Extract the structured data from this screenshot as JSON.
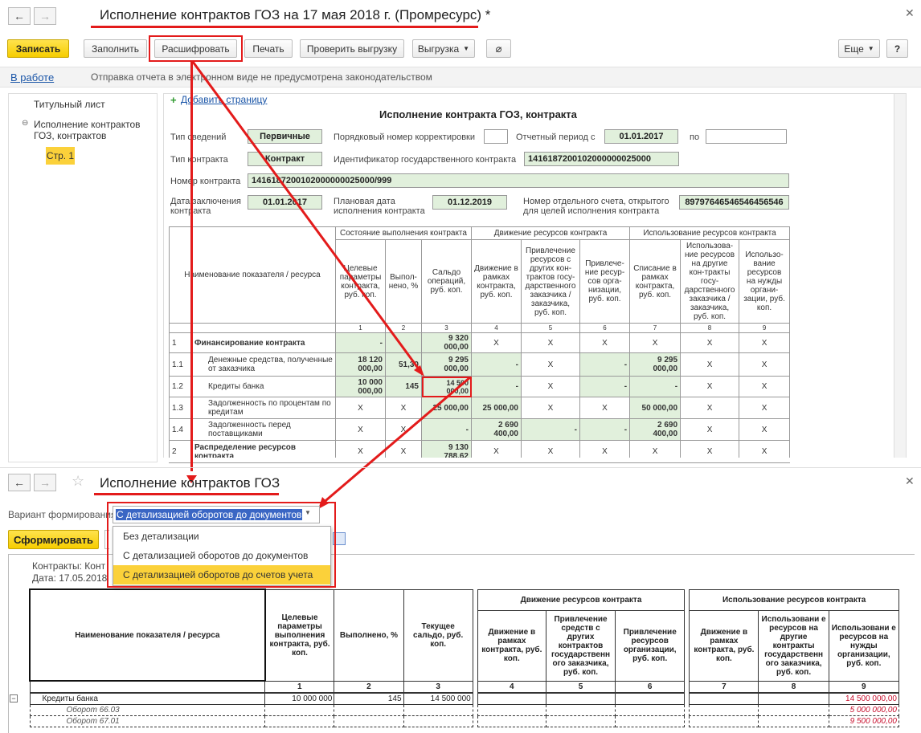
{
  "top_window": {
    "title": "Исполнение контрактов ГОЗ на 17 мая 2018 г. (Промресурс) *",
    "nav": {
      "back": "←",
      "forward": "→"
    },
    "toolbar": {
      "save": "Записать",
      "fill": "Заполнить",
      "decode": "Расшифровать",
      "print": "Печать",
      "check": "Проверить выгрузку",
      "export": "Выгрузка",
      "more": "Еще",
      "help": "?"
    },
    "status": {
      "state": "В работе",
      "message": "Отправка отчета в электронном виде не предусмотрена законодательством"
    },
    "sidebar": {
      "items": [
        "Титульный лист",
        "Исполнение контрактов ГОЗ, контрактов",
        "Стр. 1"
      ]
    },
    "form": {
      "add_page": "Добавить страницу",
      "heading": "Исполнение контракта ГОЗ, контракта",
      "info_type_label": "Тип сведений",
      "info_type": "Первичные",
      "corr_label": "Порядковый номер корректировки",
      "period_label": "Отчетный период с",
      "period_from": "01.01.2017",
      "period_to_label": "по",
      "contract_type_label": "Тип контракта",
      "contract_type": "Контракт",
      "gov_id_label": "Идентификатор государственного контракта",
      "gov_id": "1416187200102000000025000",
      "contract_no_label": "Номер контракта",
      "contract_no": "1416187200102000000025000/999",
      "date_label_1": "Дата заключения",
      "date_label_2": "контракта",
      "date": "01.01.2017",
      "plan_label_1": "Плановая дата",
      "plan_label_2": "исполнения контракта",
      "plan_date": "01.12.2019",
      "account_label_1": "Номер отдельного счета, открытого",
      "account_label_2": "для целей исполнения контракта",
      "account": "89797646546546456546"
    },
    "table": {
      "name_header": "Наименование показателя / ресурса",
      "groups": [
        "Состояние выполнения контракта",
        "Движение ресурсов контракта",
        "Использование ресурсов контракта"
      ],
      "cols": [
        "Целевые параметры контракта, руб. коп.",
        "Выпол-нено, %",
        "Сальдо операций, руб. коп.",
        "Движение в рамках контракта, руб. коп.",
        "Привлечение ресурсов с других кон-трактов госу-дарственного заказчика / заказчика, руб. коп.",
        "Привлече-ние ресур-сов орга-низации, руб. коп.",
        "Списание в рамках контракта, руб. коп.",
        "Использова-ние ресурсов на другие кон-тракты госу-дарственного заказчика / заказчика, руб. коп.",
        "Использо-вание ресурсов на нужды органи-зации, руб. коп."
      ],
      "col_numbers": [
        "1",
        "2",
        "3",
        "4",
        "5",
        "6",
        "7",
        "8",
        "9"
      ],
      "rows": [
        {
          "n": "1",
          "name": "Финансирование контракта",
          "bold": true,
          "v": [
            "-",
            "",
            "9 320 000,00",
            "X",
            "X",
            "X",
            "X",
            "X",
            "X"
          ]
        },
        {
          "n": "1.1",
          "name": "Денежные средства, полученные от заказчика",
          "v": [
            "18 120 000,00",
            "51,30",
            "9 295 000,00",
            "-",
            "X",
            "-",
            "9 295 000,00",
            "X",
            "X"
          ]
        },
        {
          "n": "1.2",
          "name": "Кредиты банка",
          "v": [
            "10 000 000,00",
            "145",
            "14 500 000,00",
            "-",
            "X",
            "-",
            "-",
            "X",
            "X"
          ]
        },
        {
          "n": "1.3",
          "name": "Задолженность по процентам по кредитам",
          "v": [
            "X",
            "X",
            "25 000,00",
            "25 000,00",
            "X",
            "X",
            "50 000,00",
            "X",
            "X"
          ]
        },
        {
          "n": "1.4",
          "name": "Задолженность перед поставщиками",
          "v": [
            "X",
            "X",
            "-",
            "2 690 400,00",
            "-",
            "-",
            "2 690 400,00",
            "X",
            "X"
          ]
        },
        {
          "n": "2",
          "name": "Распределение ресурсов контракта",
          "bold": true,
          "v": [
            "X",
            "X",
            "9 130 788,62",
            "X",
            "X",
            "X",
            "X",
            "X",
            "X"
          ]
        }
      ]
    }
  },
  "bottom_window": {
    "title": "Исполнение контрактов ГОЗ",
    "variant_label": "Вариант формирования:",
    "variant_value": "С детализацией оборотов до документов",
    "options": [
      "Без детализации",
      "С детализацией оборотов до документов",
      "С детализацией оборотов до счетов учета"
    ],
    "generate": "Сформировать",
    "report_header_1": "Контракты: Конт",
    "report_header_2": "Дата: 17.05.2018",
    "table": {
      "name_header": "Наименование показателя / ресурса",
      "cols": [
        "Целевые параметры выполнения контракта, руб. коп.",
        "Выполнено, %",
        "Текущее сальдо, руб. коп.",
        "Движение в рамках контракта, руб. коп.",
        "Привлечение средств с других контрактов государственн ого заказчика, руб. коп.",
        "Привлечение ресурсов организации, руб. коп.",
        "Движение в рамках контракта, руб. коп.",
        "Использовани е ресурсов на другие контракты государственн ого заказчика, руб. коп.",
        "Использовани е ресурсов на нужды организации, руб. коп."
      ],
      "group_move": "Движение ресурсов контракта",
      "group_use": "Использование ресурсов контракта",
      "col_numbers": [
        "1",
        "2",
        "3",
        "4",
        "5",
        "6",
        "7",
        "8",
        "9"
      ],
      "rows": [
        {
          "name": "Кредиты банка",
          "v": [
            "10 000 000",
            "145",
            "14 500 000",
            "",
            "",
            "",
            "",
            "",
            "14 500 000,00"
          ]
        },
        {
          "name": "Оборот 66.03",
          "v": [
            "",
            "",
            "",
            "",
            "",
            "",
            "",
            "",
            "5 000 000,00"
          ],
          "italic": true
        },
        {
          "name": "Оборот 67.01",
          "v": [
            "",
            "",
            "",
            "",
            "",
            "",
            "",
            "",
            "9 500 000,00"
          ],
          "italic": true
        }
      ]
    }
  },
  "colors": {
    "accent_yellow": "#f6cd00",
    "highlight_red": "#e31b1b",
    "green_cell": "#e1f0dc"
  }
}
